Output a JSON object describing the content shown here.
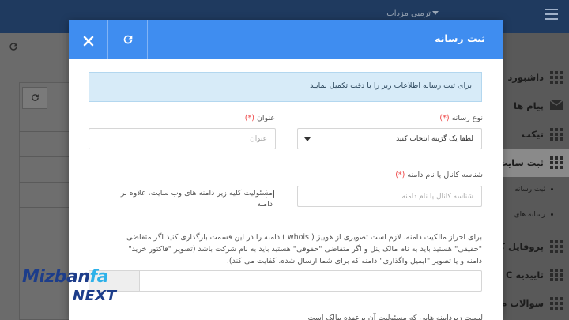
{
  "background": {
    "user_menu": "ترمیی مزداب",
    "sidebar": [
      {
        "label": "داشبورد"
      },
      {
        "label": "پیام ها"
      },
      {
        "label": "تیکت"
      },
      {
        "label": "ثبت سایت"
      },
      {
        "label": "پروفایل کا"
      },
      {
        "label": "تاییدیه C"
      },
      {
        "label": "سوالات م"
      }
    ],
    "sidebar_sub": [
      {
        "label": "ثبت رسانه"
      },
      {
        "label": "رسانه های"
      }
    ]
  },
  "modal": {
    "title": "ثبت رسانه",
    "close_icon": "close-icon",
    "refresh_icon": "refresh-icon",
    "alert": "برای ثبت رسانه اطلاعات زیر را با دقت تکمیل نمایید",
    "media_type": {
      "label": "نوع رسانه",
      "required": "(*)",
      "value": "لطفا یک گزینه انتخاب کنید"
    },
    "title_field": {
      "label": "عنوان",
      "required": "(*)",
      "placeholder": "عنوان"
    },
    "channel_id": {
      "label": "شناسه کانال یا نام دامنه",
      "required": "(*)",
      "placeholder": "شناسه کانال یا نام دامنه"
    },
    "responsibility": {
      "line1": "مسئولیت کلیه زیر دامنه های وب سایت، علاوه بر",
      "line2": "دامنه"
    },
    "ownership_text": [
      "برای احراز مالکیت دامنه، لازم است تصویری از هوییز ( whois ) دامنه را در این قسمت بارگذاری کنید اگر متقاضی",
      "\"حقیقی\" هستید باید به نام مالک پنل و اگر متقاضی \"حقوقی\" هستید باید به نام شرکت باشد (تصویر \"فاکتور خرید\"",
      "دامنه و یا تصویر \"ایمیل واگذاری\" دامنه که برای شما ارسال شده، کفایت می کند)."
    ],
    "cut_text": "لیست زیردامنه هایی که مسئولیت آن برعهده مالک است"
  },
  "logo": {
    "part1": "Mizban",
    "part2": "fa",
    "part3": "NEXT"
  },
  "colors": {
    "header": "#3f8df0",
    "alert_bg": "#d7ebf8",
    "required": "#e44444",
    "logo_dark": "#1d3d8a",
    "logo_light": "#2db1e9"
  }
}
